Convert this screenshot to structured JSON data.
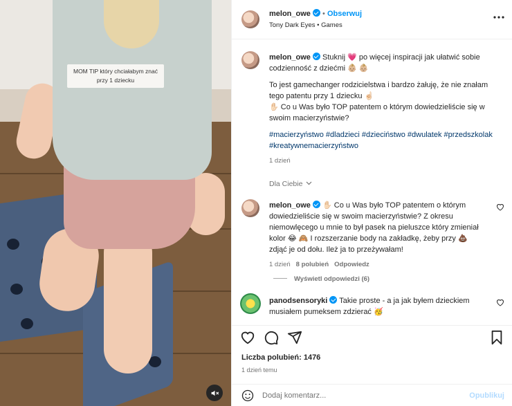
{
  "media": {
    "caption": "MOM TIP który chciałabym znać przy 1 dziecku"
  },
  "header": {
    "username": "melon_owe",
    "separator": "•",
    "follow_label": "Obserwuj",
    "audio": "Tony Dark Eyes • Games",
    "more_icon": "more-horizontal-icon"
  },
  "caption": {
    "username": "melon_owe",
    "line1": "Stuknij 💗 po więcej inspiracji jak ułatwić sobie codzienność z dziećmi 👶🏼 👶🏼",
    "line2": "To jest gamechanger rodzicielstwa i bardzo żałuję, że nie znałam tego patentu przy 1 dziecku ☝🏻",
    "line3": "✋🏻 Co u Was było TOP patentem o którym dowiedzieliście się w swoim macierzyństwie?",
    "hashtags": "#macierzyństwo #dladzieci #dzieciństwo #dwulatek #przedszkolak #kreatywnemacierzyństwo",
    "time": "1 dzień"
  },
  "for_you": "Dla Ciebie",
  "comment1": {
    "username": "melon_owe",
    "text": "✋🏻 Co u Was było TOP patentem o którym dowiedzieliście się w swoim macierzyństwie? Z okresu niemowlęcego u mnie to był pasek na pieluszce który zmieniał kolor 😂 🙈 I rozszerzanie body na zakładkę, żeby przy 💩 zdjąć je od dołu. Ileż ja to przeżywałam!",
    "time": "1 dzień",
    "likes": "8 polubień",
    "reply": "Odpowiedz",
    "view_replies": "Wyświetl odpowiedzi (6)"
  },
  "comment2": {
    "username": "panodsensoryki",
    "text": "Takie proste - a ja jak byłem dzieckiem musiałem pumeksem zdzierać 🥳"
  },
  "actions": {
    "likes_label": "Liczba polubień: 1476",
    "date": "1 dzień temu"
  },
  "composer": {
    "placeholder": "Dodaj komentarz...",
    "publish": "Opublikuj"
  },
  "colors": {
    "accent": "#0095f6",
    "hashtag": "#00376b",
    "heart": "#ed4956"
  }
}
